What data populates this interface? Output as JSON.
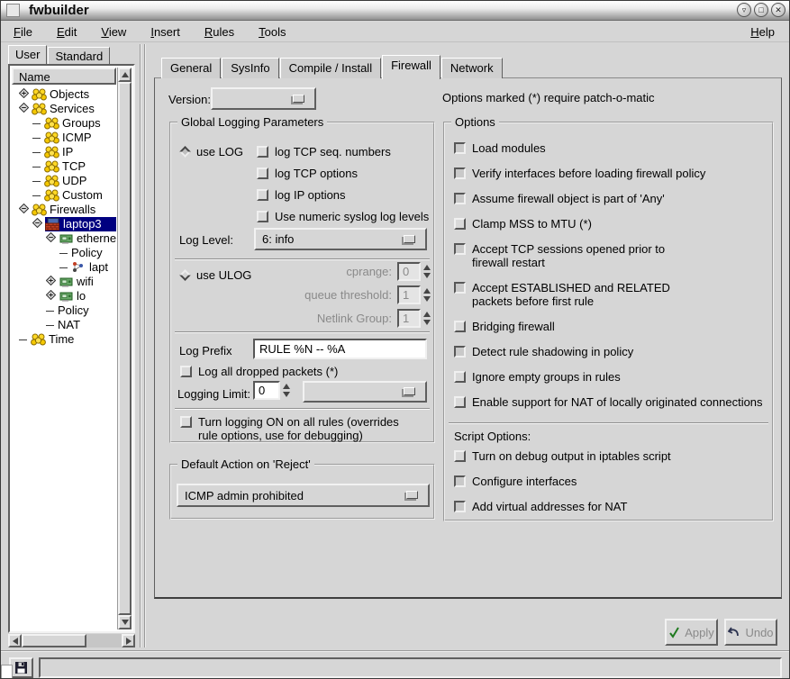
{
  "window": {
    "title": "fwbuilder",
    "controls": [
      {
        "name": "shade",
        "glyph": "▿"
      },
      {
        "name": "maximize",
        "glyph": "□"
      },
      {
        "name": "close",
        "glyph": "✕"
      }
    ]
  },
  "menubar": {
    "items": [
      "File",
      "Edit",
      "View",
      "Insert",
      "Rules",
      "Tools"
    ],
    "right_item": "Help"
  },
  "sidebar": {
    "tabs": [
      {
        "label": "User",
        "active": true
      },
      {
        "label": "Standard",
        "active": false
      }
    ],
    "column_header": "Name",
    "tree": [
      {
        "label": "Objects",
        "level": 0,
        "expander": "plus",
        "icon": "group"
      },
      {
        "label": "Services",
        "level": 0,
        "expander": "minus",
        "icon": "group"
      },
      {
        "label": "Groups",
        "level": 1,
        "icon": "group"
      },
      {
        "label": "ICMP",
        "level": 1,
        "icon": "group"
      },
      {
        "label": "IP",
        "level": 1,
        "icon": "group"
      },
      {
        "label": "TCP",
        "level": 1,
        "icon": "group"
      },
      {
        "label": "UDP",
        "level": 1,
        "icon": "group"
      },
      {
        "label": "Custom",
        "level": 1,
        "icon": "group"
      },
      {
        "label": "Firewalls",
        "level": 0,
        "expander": "minus",
        "icon": "group"
      },
      {
        "label": "laptop3",
        "level": 1,
        "expander": "minus",
        "icon": "firewall",
        "selected": true
      },
      {
        "label": "etherne",
        "level": 2,
        "expander": "minus",
        "icon": "nic"
      },
      {
        "label": "Policy",
        "level": 3
      },
      {
        "label": "lapt",
        "level": 3,
        "icon": "netmap"
      },
      {
        "label": "wifi",
        "level": 2,
        "expander": "plus",
        "icon": "nic"
      },
      {
        "label": "lo",
        "level": 2,
        "expander": "plus",
        "icon": "nic"
      },
      {
        "label": "Policy",
        "level": 2
      },
      {
        "label": "NAT",
        "level": 2
      },
      {
        "label": "Time",
        "level": 0,
        "icon": "group"
      }
    ]
  },
  "main": {
    "tabs": [
      {
        "label": "General",
        "active": false
      },
      {
        "label": "SysInfo",
        "active": false
      },
      {
        "label": "Compile / Install",
        "active": false
      },
      {
        "label": "Firewall",
        "active": true
      },
      {
        "label": "Network",
        "active": false
      }
    ],
    "version_label": "Version:",
    "version_value": "",
    "patch_note": "Options marked (*) require patch-o-matic",
    "logging": {
      "title": "Global Logging Parameters",
      "use_log": {
        "label": "use LOG",
        "selected": true
      },
      "log_checkboxes": [
        {
          "label": "log TCP seq. numbers",
          "checked": false
        },
        {
          "label": "log TCP options",
          "checked": false
        },
        {
          "label": "log IP options",
          "checked": false
        },
        {
          "label": "Use numeric syslog log levels",
          "checked": false
        }
      ],
      "log_level_label": "Log Level:",
      "log_level_value": "6: info",
      "use_ulog": {
        "label": "use ULOG",
        "selected": false
      },
      "ulog_fields": [
        {
          "label": "cprange:",
          "value": "0"
        },
        {
          "label": "queue threshold:",
          "value": "1"
        },
        {
          "label": "Netlink Group:",
          "value": "1"
        }
      ],
      "log_prefix_label": "Log Prefix",
      "log_prefix_value": "RULE %N -- %A",
      "log_all_dropped": {
        "label": "Log all dropped packets (*)",
        "checked": false
      },
      "logging_limit_label": "Logging Limit:",
      "logging_limit_value": "0",
      "turn_logging_on": {
        "label": "Turn logging ON on all rules (overrides\nrule options, use for debugging)",
        "checked": false
      }
    },
    "default_action": {
      "title": "Default Action on 'Reject'",
      "value": "ICMP admin prohibited"
    },
    "options": {
      "title": "Options",
      "items": [
        {
          "label": "Load modules",
          "checked": true
        },
        {
          "label": "Verify interfaces before loading firewall policy",
          "checked": true
        },
        {
          "label": "Assume firewall object  is part of  'Any'",
          "checked": true
        },
        {
          "label": "Clamp MSS to MTU (*)",
          "checked": false
        },
        {
          "label": "Accept TCP sessions opened prior to\nfirewall restart",
          "checked": true
        },
        {
          "label": "Accept ESTABLISHED and RELATED\npackets before first rule",
          "checked": true
        },
        {
          "label": "Bridging firewall",
          "checked": false
        },
        {
          "label": "Detect rule shadowing in policy",
          "checked": true
        },
        {
          "label": "Ignore empty groups in rules",
          "checked": false
        },
        {
          "label": "Enable support for NAT of locally originated connections",
          "checked": false
        }
      ],
      "script_title": "Script Options:",
      "script_items": [
        {
          "label": "Turn on debug output in iptables script",
          "checked": false
        },
        {
          "label": "Configure interfaces",
          "checked": true
        },
        {
          "label": "Add virtual addresses for NAT",
          "checked": true
        }
      ]
    },
    "buttons": {
      "apply": "Apply",
      "undo": "Undo"
    }
  },
  "colors": {
    "selection": "#000080",
    "apply_check": "#1f7a1f",
    "undo_arrow": "#2c3350",
    "background": "#d6d6d6"
  }
}
